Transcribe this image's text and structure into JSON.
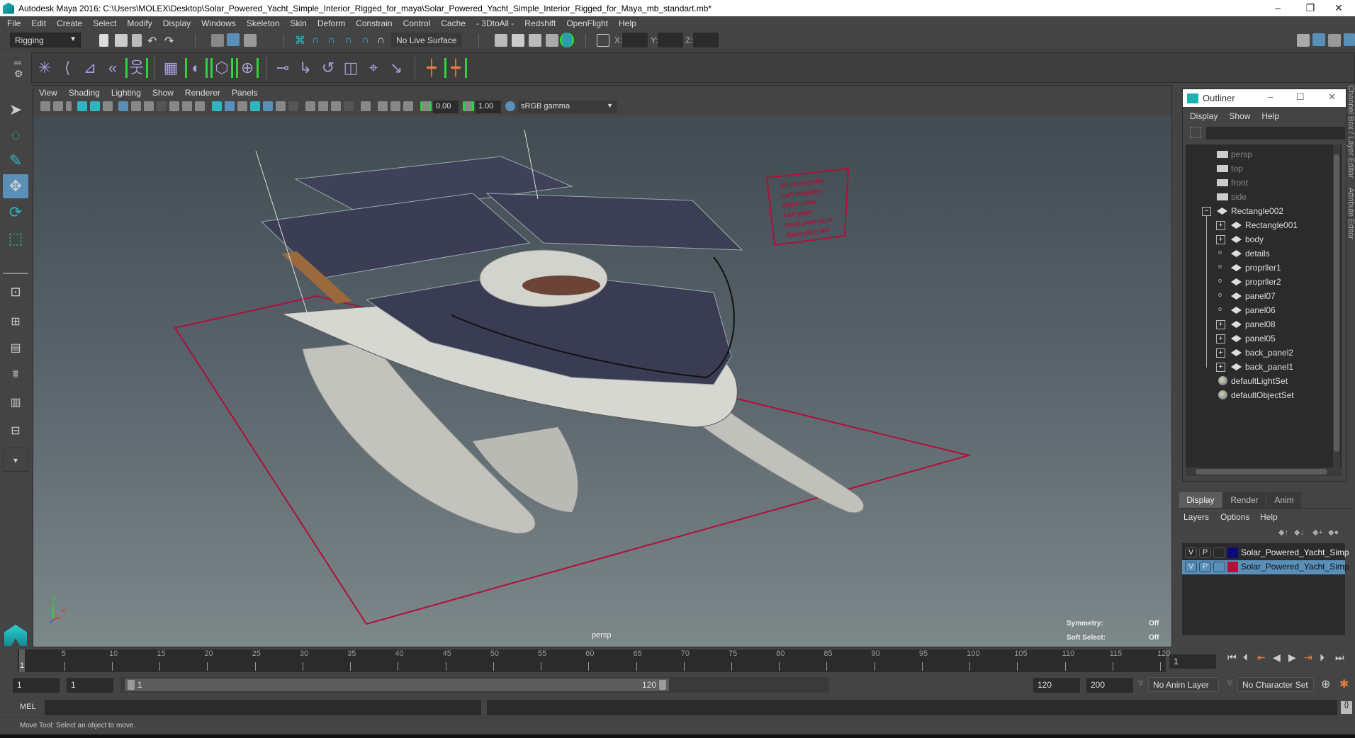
{
  "window": {
    "title": "Autodesk Maya 2016: C:\\Users\\MOLEX\\Desktop\\Solar_Powered_Yacht_Simple_Interior_Rigged_for_maya\\Solar_Powered_Yacht_Simple_Interior_Rigged_for_Maya_mb_standart.mb*",
    "controls": {
      "minimize": "–",
      "restore": "❐",
      "close": "✕"
    }
  },
  "menubar": [
    "File",
    "Edit",
    "Create",
    "Select",
    "Modify",
    "Display",
    "Windows",
    "Skeleton",
    "Skin",
    "Deform",
    "Constrain",
    "Control",
    "Cache",
    "- 3DtoAll -",
    "Redshift",
    "OpenFlight",
    "Help"
  ],
  "statusline": {
    "menuset": "Rigging",
    "live_surface": "No Live Surface",
    "x_label": "X:",
    "y_label": "Y:",
    "z_label": "Z:",
    "x_value": "",
    "y_value": "",
    "z_value": ""
  },
  "shelf": {
    "icons": [
      "joint-tool",
      "ik-handle",
      "ik-spline",
      "bend-joint",
      "quick-rig",
      "component-editor",
      "paint-skin-weights",
      "lattice",
      "cluster",
      "parent-constraint",
      "point-constraint",
      "orient-constraint",
      "scale-constraint",
      "aim-constraint",
      "pole-vector",
      "lock-unlock",
      "hide-joints"
    ]
  },
  "toolbox": [
    "select-tool",
    "lasso-tool",
    "paint-select-tool",
    "move-tool",
    "rotate-tool",
    "scale-tool"
  ],
  "viewport": {
    "menu": [
      "View",
      "Shading",
      "Lighting",
      "Show",
      "Renderer",
      "Panels"
    ],
    "exposure": "0.00",
    "gamma": "1.00",
    "color_space": "sRGB gamma",
    "camera_label": "persp",
    "symmetry_label": "Symmetry:",
    "symmetry_value": "Off",
    "soft_select_label": "Soft Select:",
    "soft_select_value": "Off",
    "legend": [
      "Right propeller",
      "Left propeller",
      "Right plate",
      "Left plate",
      "Back plate right",
      "Back plate left"
    ],
    "axis": {
      "x": "x",
      "y": "y",
      "z": "z"
    }
  },
  "outliner": {
    "title": "Outliner",
    "menu": [
      "Display",
      "Show",
      "Help"
    ],
    "search_value": "",
    "cameras": [
      "persp",
      "top",
      "front",
      "side"
    ],
    "root": "Rectangle002",
    "children": [
      {
        "name": "Rectangle001",
        "expandable": true
      },
      {
        "name": "body",
        "expandable": true
      },
      {
        "name": "details",
        "expandable": false
      },
      {
        "name": "proprller1",
        "expandable": false
      },
      {
        "name": "proprller2",
        "expandable": false
      },
      {
        "name": "panel07",
        "expandable": false
      },
      {
        "name": "panel06",
        "expandable": false
      },
      {
        "name": "panel08",
        "expandable": true
      },
      {
        "name": "panel05",
        "expandable": true
      },
      {
        "name": "back_panel2",
        "expandable": true
      },
      {
        "name": "back_panel1",
        "expandable": true
      }
    ],
    "sets": [
      "defaultLightSet",
      "defaultObjectSet"
    ]
  },
  "side_tabs": [
    "Channel Box / Layer Editor",
    "Attribute Editor"
  ],
  "layer_editor": {
    "tabs": [
      "Display",
      "Render",
      "Anim"
    ],
    "active_tab": "Display",
    "menu": [
      "Layers",
      "Options",
      "Help"
    ],
    "layers": [
      {
        "v": "V",
        "p": "P",
        "color": "#0a0a78",
        "name": "Solar_Powered_Yacht_Simp",
        "selected": false
      },
      {
        "v": "V",
        "p": "P",
        "color": "#b0103a",
        "name": "Solar_Powered_Yacht_Simp",
        "selected": true
      }
    ]
  },
  "timeline": {
    "ticks": [
      5,
      10,
      15,
      20,
      25,
      30,
      35,
      40,
      45,
      50,
      55,
      60,
      65,
      70,
      75,
      80,
      85,
      90,
      95,
      100,
      105,
      110,
      115,
      120
    ],
    "current_frame_marker": "1",
    "current_frame": "1",
    "range_start": 1,
    "range_end": 120
  },
  "range": {
    "start": "1",
    "anim_start": "1",
    "slider_start": "1",
    "slider_end": "120",
    "playback_end": "120",
    "anim_end": "200",
    "anim_layer": "No Anim Layer",
    "character_set": "No Character Set"
  },
  "command_line": {
    "language": "MEL",
    "input": "",
    "result": ""
  },
  "help_line": "Move Tool: Select an object to move.",
  "colors": {
    "accent": "#5a8fb8",
    "highlight_green": "#2dd43b",
    "curve_red": "#b0103a",
    "panel": "#444444",
    "field": "#2b2b2b"
  }
}
